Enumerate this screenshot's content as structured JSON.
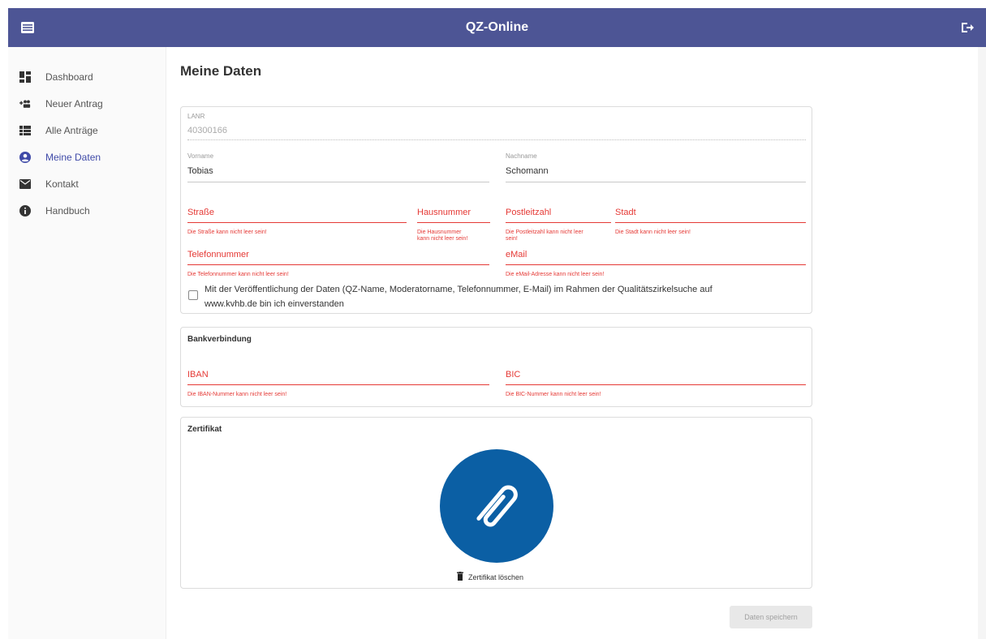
{
  "app": {
    "title": "QZ-Online"
  },
  "colors": {
    "topbar": "#4d5595",
    "accent": "#3f4aa8",
    "error": "#e53935",
    "attachment": "#0b5fa4"
  },
  "sidebar": {
    "items": [
      {
        "label": "Dashboard",
        "icon": "dashboard-icon",
        "active": false
      },
      {
        "label": "Neuer Antrag",
        "icon": "group-add-icon",
        "active": false
      },
      {
        "label": "Alle Anträge",
        "icon": "list-icon",
        "active": false
      },
      {
        "label": "Meine Daten",
        "icon": "account-circle-icon",
        "active": true
      },
      {
        "label": "Kontakt",
        "icon": "mail-icon",
        "active": false
      },
      {
        "label": "Handbuch",
        "icon": "info-icon",
        "active": false
      }
    ]
  },
  "page": {
    "title": "Meine Daten"
  },
  "personal": {
    "lanr": {
      "label": "LANR",
      "value": "40300166"
    },
    "vorname": {
      "label": "Vorname",
      "value": "Tobias"
    },
    "nachname": {
      "label": "Nachname",
      "value": "Schomann"
    },
    "strasse": {
      "label": "Straße",
      "error": "Die Straße kann nicht leer sein!"
    },
    "hausnummer": {
      "label": "Hausnummer",
      "error_line1": "Die Hausnummer",
      "error_line2": "kann nicht leer sein!"
    },
    "postleitzahl": {
      "label": "Postleitzahl",
      "error_line1": "Die Postleitzahl kann nicht leer",
      "error_line2": "sein!"
    },
    "stadt": {
      "label": "Stadt",
      "error": "Die Stadt kann nicht leer sein!"
    },
    "telefon": {
      "label": "Telefonnummer",
      "error": "Die Telefonnummer kann nicht leer sein!"
    },
    "email": {
      "label": "eMail",
      "error": "Die eMail-Adresse kann nicht leer sein!"
    },
    "consent_line1": "Mit der Veröffentlichung der Daten (QZ-Name, Moderatorname, Telefonnummer, E-Mail) im Rahmen der Qualitätszirkelsuche auf",
    "consent_line2": "www.kvhb.de bin ich einverstanden"
  },
  "bank": {
    "title": "Bankverbindung",
    "iban": {
      "label": "IBAN",
      "error": "Die IBAN-Nummer kann nicht leer sein!"
    },
    "bic": {
      "label": "BIC",
      "error": "Die BIC-Nummer kann nicht leer sein!"
    }
  },
  "certificate": {
    "title": "Zertifikat",
    "delete_label": "Zertifikat löschen"
  },
  "save_label": "Daten speichern"
}
